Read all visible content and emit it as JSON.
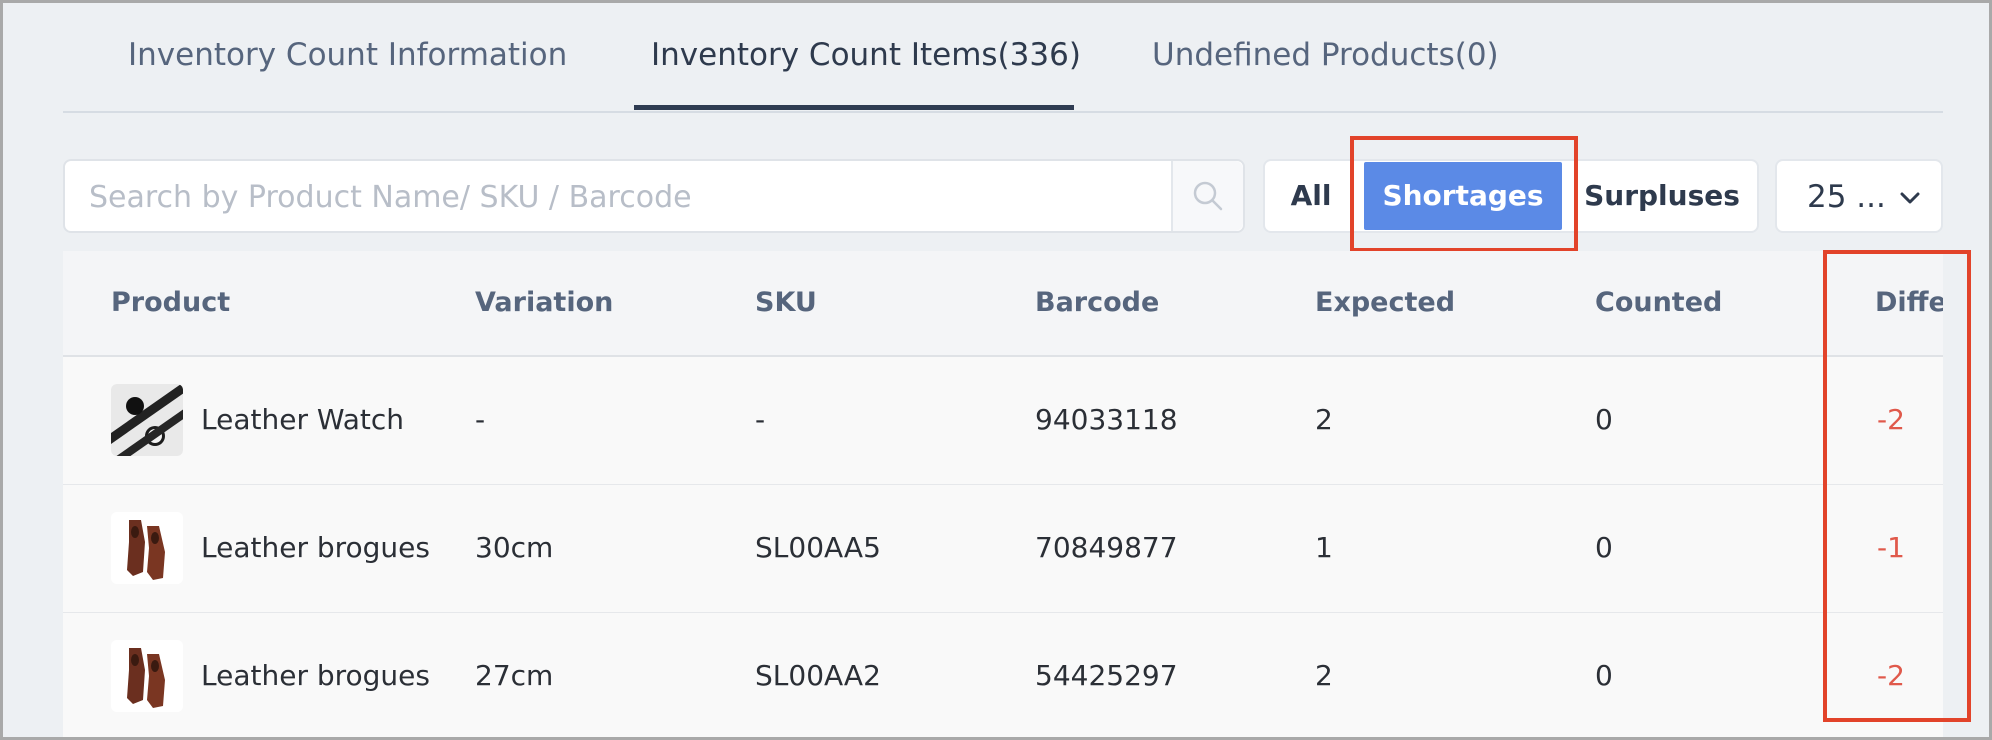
{
  "tabs": [
    {
      "label": "Inventory Count Information"
    },
    {
      "label": "Inventory Count Items(336)"
    },
    {
      "label": "Undefined Products(0)"
    }
  ],
  "search": {
    "placeholder": "Search by Product Name/ SKU / Barcode"
  },
  "filters": {
    "all": "All",
    "shortages": "Shortages",
    "surpluses": "Surpluses",
    "active": "Shortages"
  },
  "page_size": {
    "value": "25 ..."
  },
  "table": {
    "columns": [
      "Product",
      "Variation",
      "SKU",
      "Barcode",
      "Expected",
      "Counted",
      "Diffe"
    ],
    "rows": [
      {
        "product": "Leather Watch",
        "variation": "-",
        "sku": "-",
        "barcode": "94033118",
        "expected": "2",
        "counted": "0",
        "difference": "-2",
        "thumb": "watch-thumbnail"
      },
      {
        "product": "Leather brogues",
        "variation": "30cm",
        "sku": "SL00AA5",
        "barcode": "70849877",
        "expected": "1",
        "counted": "0",
        "difference": "-1",
        "thumb": "shoe-thumbnail"
      },
      {
        "product": "Leather brogues",
        "variation": "27cm",
        "sku": "SL00AA2",
        "barcode": "54425297",
        "expected": "2",
        "counted": "0",
        "difference": "-2",
        "thumb": "shoe-thumbnail"
      }
    ]
  },
  "colors": {
    "accent": "#5b8ae6",
    "highlight": "#e2432a",
    "negative": "#e0594b"
  },
  "icons": {
    "search": "search-icon",
    "dropdown": "chevron-down-icon"
  }
}
